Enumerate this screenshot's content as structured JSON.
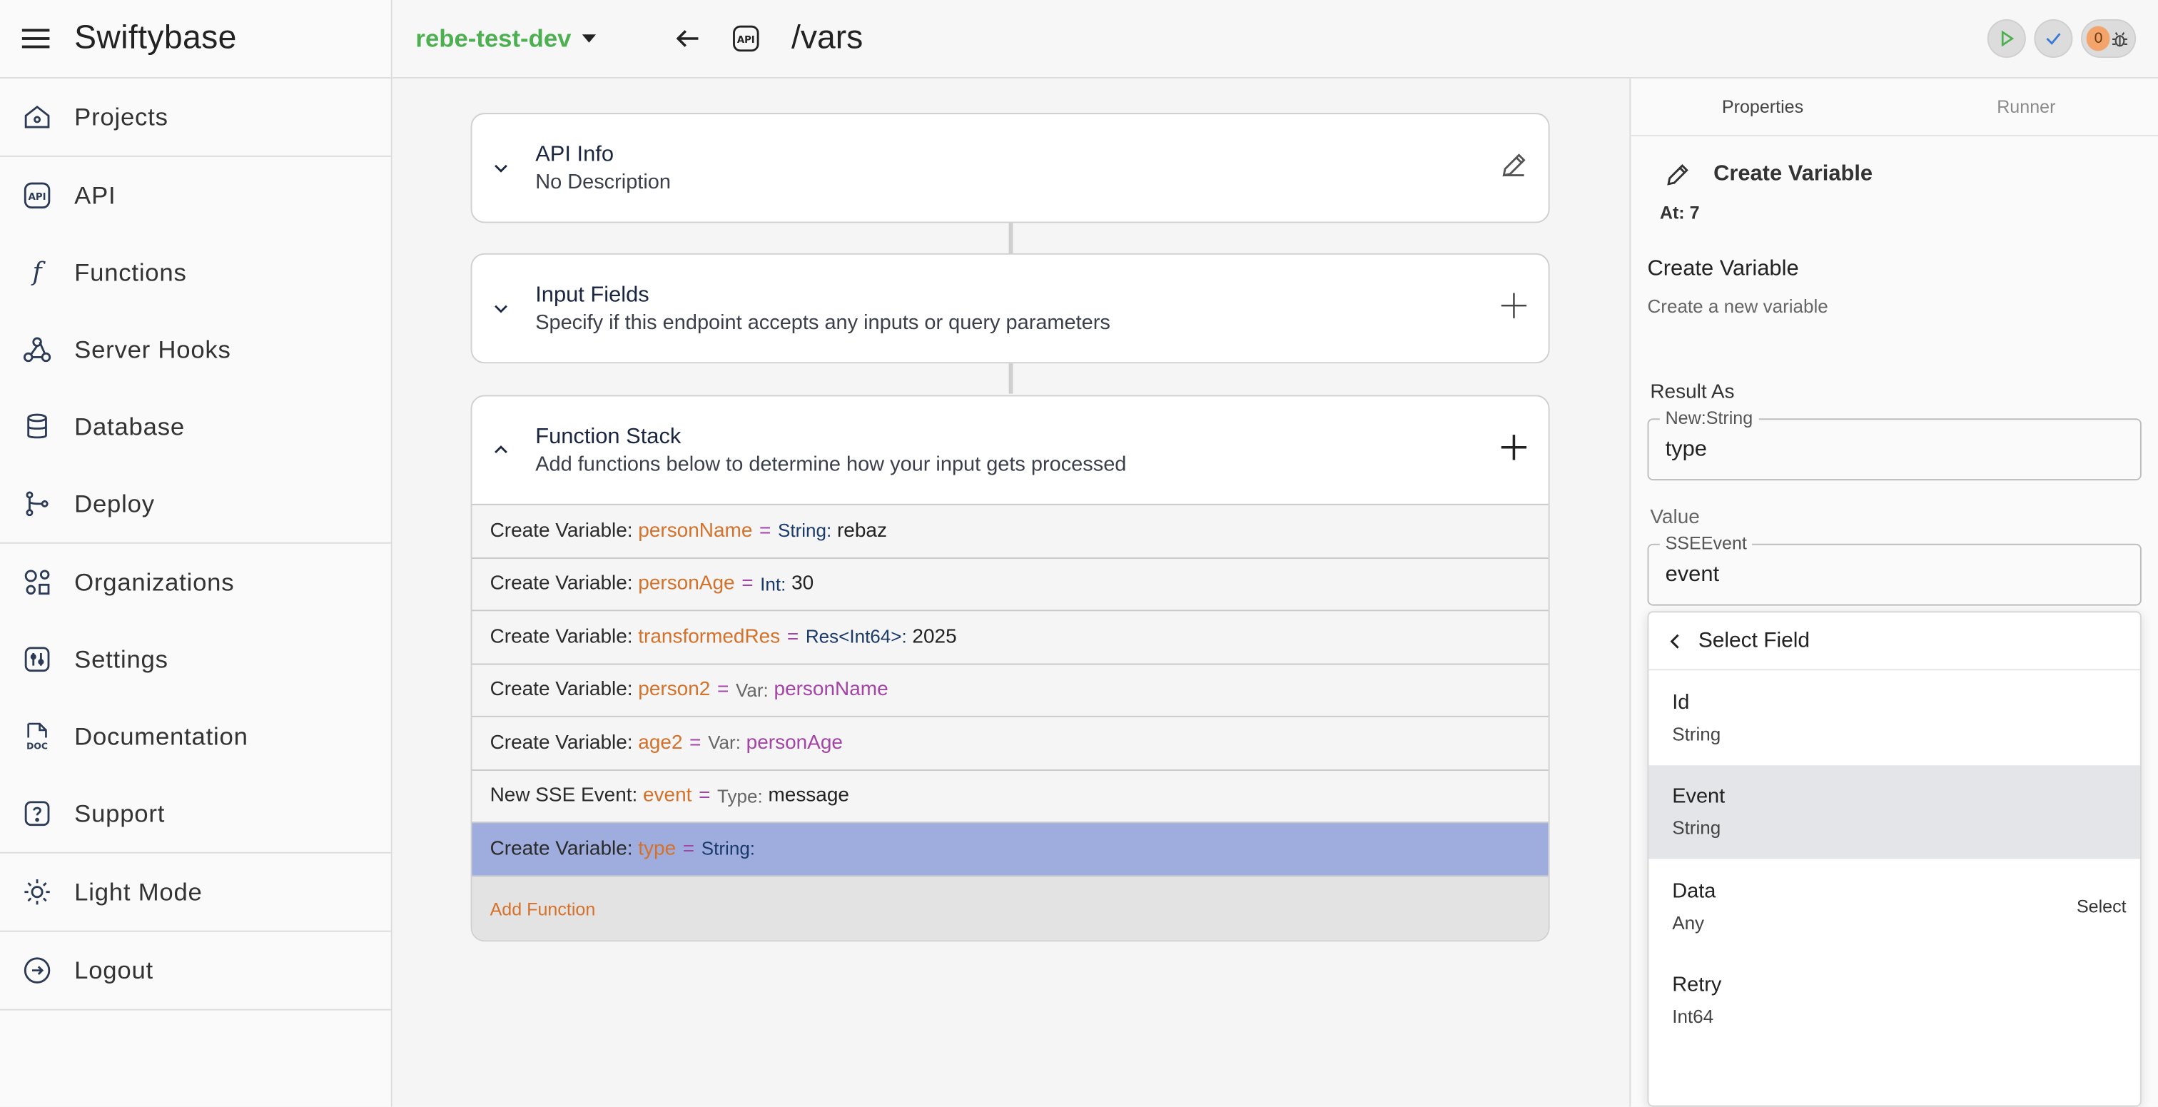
{
  "app": {
    "title": "Swiftybase"
  },
  "sidebar": {
    "items": [
      {
        "label": "Projects",
        "icon": "home-icon"
      },
      {
        "label": "API",
        "icon": "api-icon"
      },
      {
        "label": "Functions",
        "icon": "function-icon"
      },
      {
        "label": "Server Hooks",
        "icon": "webhook-icon"
      },
      {
        "label": "Database",
        "icon": "database-icon"
      },
      {
        "label": "Deploy",
        "icon": "git-branch-icon"
      },
      {
        "label": "Organizations",
        "icon": "organizations-icon"
      },
      {
        "label": "Settings",
        "icon": "settings-icon"
      },
      {
        "label": "Documentation",
        "icon": "doc-icon"
      },
      {
        "label": "Support",
        "icon": "help-icon"
      },
      {
        "label": "Light Mode",
        "icon": "sun-icon"
      },
      {
        "label": "Logout",
        "icon": "logout-icon"
      }
    ]
  },
  "topbar": {
    "environment": "rebe-test-dev",
    "path": "/vars",
    "api_badge": "API",
    "error_count": "0"
  },
  "cards": {
    "api_info": {
      "title": "API Info",
      "subtitle": "No Description"
    },
    "input_fields": {
      "title": "Input Fields",
      "subtitle": "Specify if this endpoint accepts any inputs or query parameters"
    },
    "function_stack": {
      "title": "Function Stack",
      "subtitle": "Add functions below to determine how your input gets processed"
    }
  },
  "stack": [
    {
      "prefix": "Create Variable:",
      "name": "personName",
      "eq": "=",
      "type": "String:",
      "value": "rebaz",
      "value_kind": "literal"
    },
    {
      "prefix": "Create Variable:",
      "name": "personAge",
      "eq": "=",
      "type": "Int:",
      "value": "30",
      "value_kind": "literal"
    },
    {
      "prefix": "Create Variable:",
      "name": "transformedRes",
      "eq": "=",
      "type": "Res<Int64>:",
      "value": "2025",
      "value_kind": "literal"
    },
    {
      "prefix": "Create Variable:",
      "name": "person2",
      "eq": "=",
      "type": "Var:",
      "value": "personName",
      "value_kind": "var"
    },
    {
      "prefix": "Create Variable:",
      "name": "age2",
      "eq": "=",
      "type": "Var:",
      "value": "personAge",
      "value_kind": "var"
    },
    {
      "prefix": "New SSE Event:",
      "name": "event",
      "eq": "=",
      "type": "Type:",
      "value": "message",
      "value_kind": "literal"
    },
    {
      "prefix": "Create Variable:",
      "name": "type",
      "eq": "=",
      "type": "String:",
      "value": "",
      "value_kind": "literal",
      "selected": true
    }
  ],
  "add_function_label": "Add Function",
  "panel": {
    "tabs": [
      "Properties",
      "Runner"
    ],
    "header": "Create Variable",
    "at": "At: 7",
    "section_title": "Create Variable",
    "section_desc": "Create a new variable",
    "result_label": "Result As",
    "result_legend": "New:String",
    "result_value": "type",
    "value_label": "Value",
    "value_legend": "SSEEvent",
    "value_value": "event",
    "dropdown": {
      "title": "Select Field",
      "items": [
        {
          "name": "Id",
          "type": "String"
        },
        {
          "name": "Event",
          "type": "String",
          "highlighted": true
        },
        {
          "name": "Data",
          "type": "Any",
          "action": "Select"
        },
        {
          "name": "Retry",
          "type": "Int64"
        }
      ]
    }
  },
  "colors": {
    "accent_green": "#4caf50",
    "var_name": "#d4712a",
    "operator": "#a444a6",
    "selected_row": "#9fadde"
  }
}
